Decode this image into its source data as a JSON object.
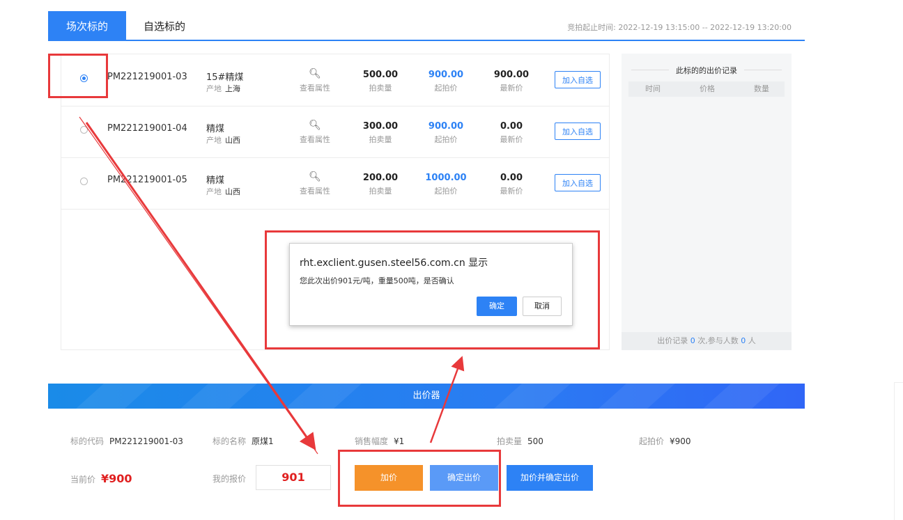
{
  "tabs": {
    "active": "场次标的",
    "other": "自选标的"
  },
  "auction_time": {
    "label": "竞拍起止时间:",
    "value": "2022-12-19 13:15:00 -- 2022-12-19 13:20:00"
  },
  "lots": [
    {
      "selected": true,
      "code": "PM221219001-03",
      "name": "15#精煤",
      "origin_label": "产地",
      "origin": "上海",
      "attr_label": "查看属性",
      "qty": "500.00",
      "qty_label": "拍卖量",
      "start": "900.00",
      "start_label": "起拍价",
      "latest": "900.00",
      "latest_label": "最新价",
      "add_label": "加入自选"
    },
    {
      "selected": false,
      "code": "PM221219001-04",
      "name": "精煤",
      "origin_label": "产地",
      "origin": "山西",
      "attr_label": "查看属性",
      "qty": "300.00",
      "qty_label": "拍卖量",
      "start": "900.00",
      "start_label": "起拍价",
      "latest": "0.00",
      "latest_label": "最新价",
      "add_label": "加入自选"
    },
    {
      "selected": false,
      "code": "PM221219001-05",
      "name": "精煤",
      "origin_label": "产地",
      "origin": "山西",
      "attr_label": "查看属性",
      "qty": "200.00",
      "qty_label": "拍卖量",
      "start": "1000.00",
      "start_label": "起拍价",
      "latest": "0.00",
      "latest_label": "最新价",
      "add_label": "加入自选"
    }
  ],
  "records": {
    "title": "此标的的出价记录",
    "columns": [
      "时间",
      "价格",
      "数量"
    ],
    "footer_prefix": "出价记录",
    "count": "0",
    "footer_mid": "次,参与人数",
    "people": "0",
    "footer_suffix": "人"
  },
  "dialog": {
    "title": "rht.exclient.gusen.steel56.com.cn 显示",
    "message": "您此次出价901元/吨，重量500吨，是否确认",
    "ok": "确定",
    "cancel": "取消"
  },
  "bidder": {
    "title": "出价器",
    "code_label": "标的代码",
    "code": "PM221219001-03",
    "name_label": "标的名称",
    "name": "原煤1",
    "step_label": "销售幅度",
    "step": "¥1",
    "qty_label": "拍卖量",
    "qty": "500",
    "start_label": "起拍价",
    "start": "¥900",
    "current_label": "当前价",
    "current": "¥900",
    "my_bid_label": "我的报价",
    "my_bid": "901",
    "btn_add": "加价",
    "btn_confirm": "确定出价",
    "btn_add_confirm": "加价并确定出价"
  },
  "colors": {
    "primary": "#2d82f5",
    "orange": "#f5922a",
    "annotation": "#e8393b",
    "price_red": "#e02020"
  }
}
